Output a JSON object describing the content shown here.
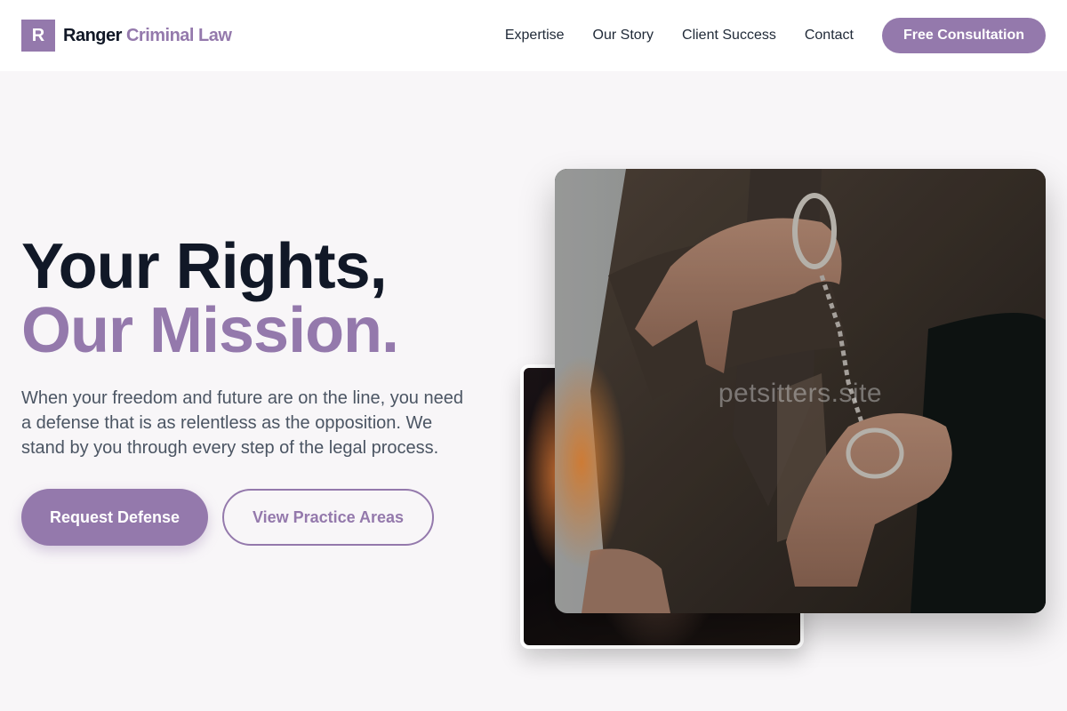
{
  "brand": {
    "mark": "R",
    "name_primary": "Ranger",
    "name_accent": "Criminal Law"
  },
  "nav": {
    "links": [
      "Expertise",
      "Our Story",
      "Client Success",
      "Contact"
    ],
    "cta": "Free Consultation"
  },
  "hero": {
    "title_line1": "Your Rights,",
    "title_line2": "Our Mission.",
    "lead": "When your freedom and future are on the line, you need a defense that is as relentless as the opposition. We stand by you through every step of the legal process.",
    "primary_button": "Request Defense",
    "secondary_button": "View Practice Areas"
  },
  "images": {
    "watermark": "petsitters.site"
  },
  "colors": {
    "accent": "#9479ac",
    "dark": "#111827",
    "background": "#f8f6f8"
  }
}
